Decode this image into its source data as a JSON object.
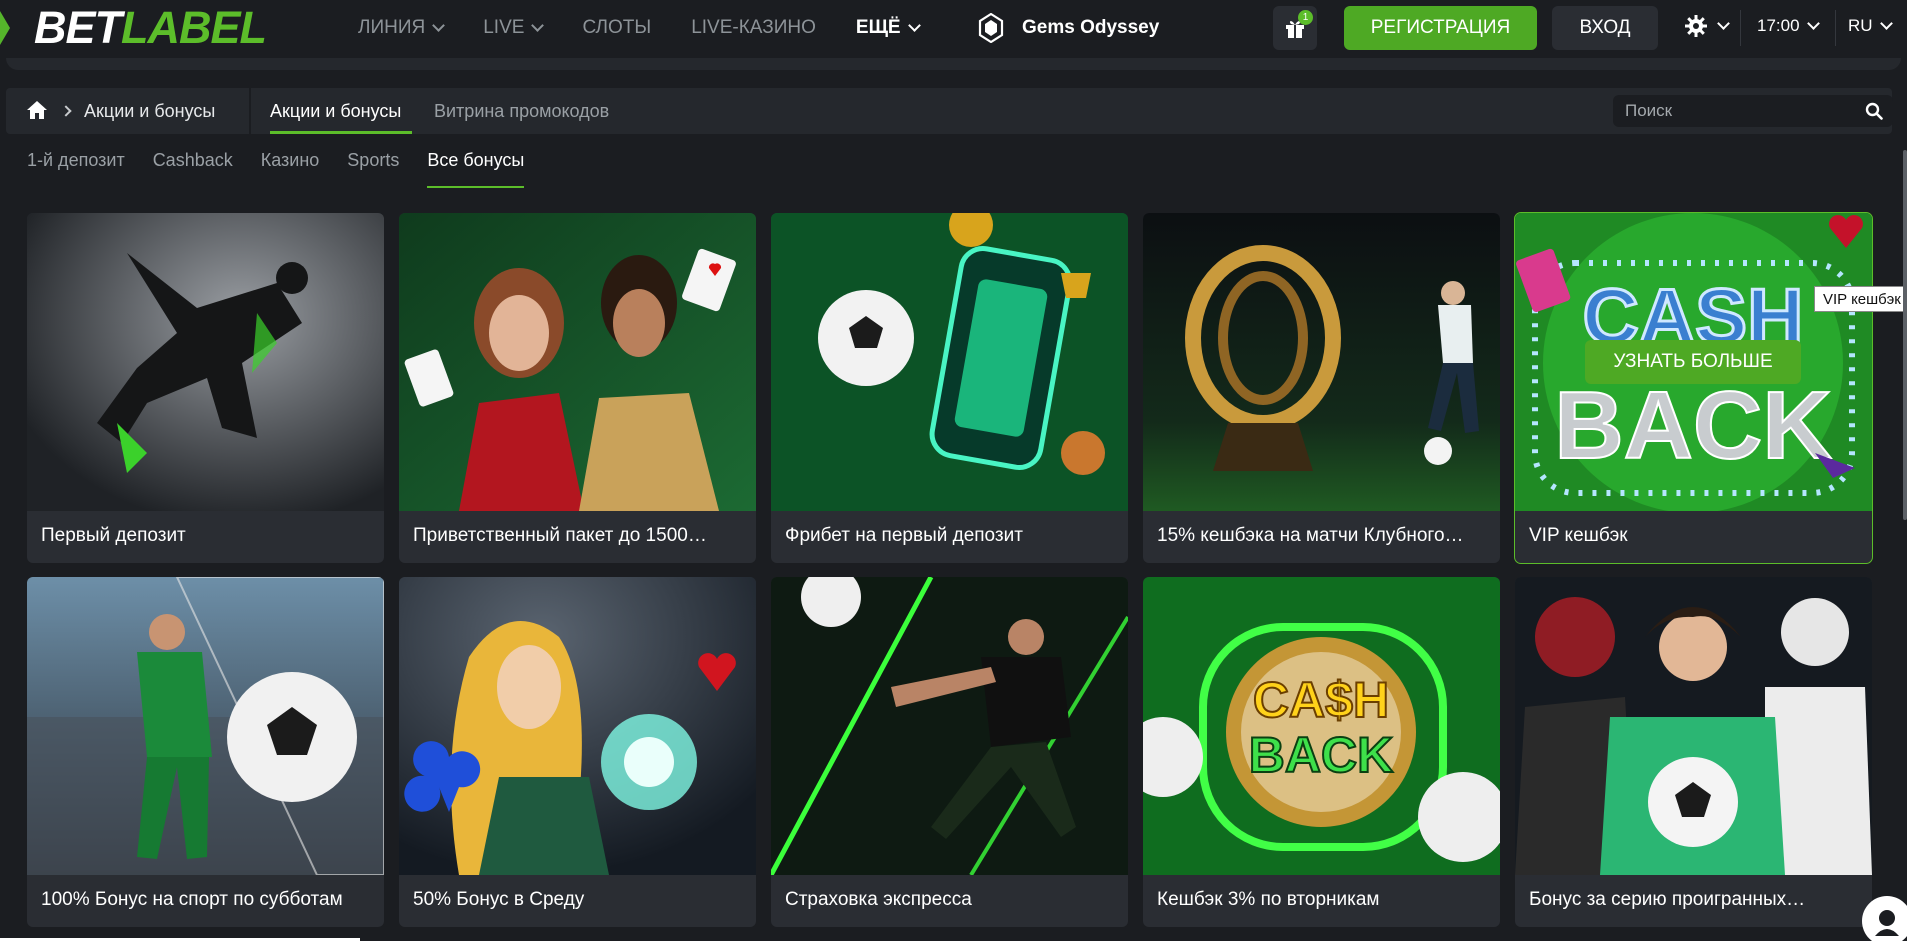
{
  "header": {
    "logo_bet": "BET",
    "logo_label": "LABEL",
    "nav": [
      {
        "label": "ЛИНИЯ",
        "has_dropdown": true
      },
      {
        "label": "LIVE",
        "has_dropdown": true
      },
      {
        "label": "СЛОТЫ",
        "has_dropdown": false
      },
      {
        "label": "LIVE-КАЗИНО",
        "has_dropdown": false
      },
      {
        "label": "ЕЩЁ",
        "has_dropdown": true
      }
    ],
    "promo_game": "Gems Odyssey",
    "gift_badge": "1",
    "register_label": "РЕГИСТРАЦИЯ",
    "login_label": "ВХОД",
    "time": "17:00",
    "lang": "RU"
  },
  "breadcrumb": {
    "current": "Акции и бонусы",
    "subtabs": [
      {
        "label": "Акции и бонусы",
        "active": true
      },
      {
        "label": "Витрина промокодов",
        "active": false
      }
    ],
    "search_placeholder": "Поиск"
  },
  "categories": [
    {
      "label": "1-й депозит",
      "active": false
    },
    {
      "label": "Cashback",
      "active": false
    },
    {
      "label": "Казино",
      "active": false
    },
    {
      "label": "Sports",
      "active": false
    },
    {
      "label": "Все бонусы",
      "active": true
    }
  ],
  "cards": [
    {
      "title": "Первый депозит",
      "image": "footballer-kick"
    },
    {
      "title": "Приветственный пакет до 1500…",
      "image": "casino-women"
    },
    {
      "title": "Фрибет на первый депозит",
      "image": "soccer-phone-field"
    },
    {
      "title": "15% кешбэка на матчи Клубного…",
      "image": "trophy-footballer"
    },
    {
      "title": "VIP кешбэк",
      "image": "cashback-sign",
      "cta": "УЗНАТЬ БОЛЬШЕ"
    },
    {
      "title": "100% Бонус на спорт по субботам",
      "image": "goal-celebration"
    },
    {
      "title": "50% Бонус в Среду",
      "image": "magic-woman"
    },
    {
      "title": "Страховка экспресса",
      "image": "footballer-neon"
    },
    {
      "title": "Кешбэк 3% по вторникам",
      "image": "cashback-badge"
    },
    {
      "title": "Бонус за серию проигранных…",
      "image": "sports-men"
    }
  ],
  "tooltip": "VIP кешбэк",
  "colors": {
    "accent": "#5cbd2a",
    "background": "#1b1d21",
    "panel": "#25282d",
    "card": "#2a2d33"
  }
}
